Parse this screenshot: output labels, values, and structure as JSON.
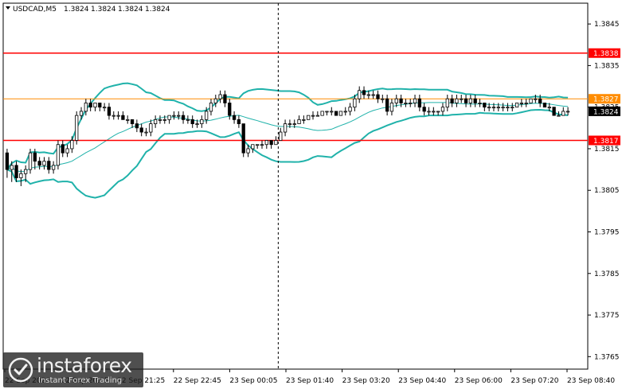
{
  "header": {
    "symbol_label": "USDCAD,M5",
    "ohlc": [
      "1.3824",
      "1.3824",
      "1.3824",
      "1.3824"
    ]
  },
  "logo": {
    "brand": "instaforex",
    "tagline": "Instant Forex Trading",
    "icon": "instaforex-logo-icon"
  },
  "colors": {
    "candle": "#000000",
    "bollinger": "#20b2aa",
    "level_line": "#ff0000",
    "ask_line": "#ff8c00",
    "price_label_bg": "#ff0000",
    "current_label_bg": "#000000",
    "grid_vline": "#000000",
    "axis_text": "#000000"
  },
  "chart_data": {
    "type": "candlestick",
    "symbol": "USDCAD",
    "timeframe": "M5",
    "ylim": [
      1.3762,
      1.385
    ],
    "yticks": [
      "1.3845",
      "1.3835",
      "1.3825",
      "1.3815",
      "1.3805",
      "1.3795",
      "1.3785",
      "1.3775",
      "1.3765"
    ],
    "xticks": [
      "22 Sep 2020",
      "22 Sep 20:05",
      "22 Sep 21:25",
      "22 Sep 22:45",
      "23 Sep 00:05",
      "23 Sep 01:40",
      "23 Sep 03:20",
      "23 Sep 04:40",
      "23 Sep 06:00",
      "23 Sep 07:20",
      "23 Sep 08:40"
    ],
    "horizontal_levels": [
      {
        "price": 1.3838,
        "label": "1.3838",
        "style": "resistance"
      },
      {
        "price": 1.3817,
        "label": "1.3817",
        "style": "support"
      }
    ],
    "ask_line": {
      "price": 1.3827,
      "label": "1.3827"
    },
    "current_price": {
      "price": 1.3824,
      "label": "1.3824"
    },
    "period_separator_index": 59,
    "candles": [
      [
        1.3814,
        1.3815,
        1.3808,
        1.381
      ],
      [
        1.381,
        1.3812,
        1.3807,
        1.3811
      ],
      [
        1.3811,
        1.3812,
        1.3807,
        1.3808
      ],
      [
        1.3808,
        1.381,
        1.3806,
        1.3809
      ],
      [
        1.3809,
        1.3811,
        1.3807,
        1.381
      ],
      [
        1.381,
        1.3815,
        1.3809,
        1.3814
      ],
      [
        1.3814,
        1.3815,
        1.381,
        1.3812
      ],
      [
        1.3812,
        1.3813,
        1.381,
        1.3811
      ],
      [
        1.3811,
        1.3813,
        1.381,
        1.3812
      ],
      [
        1.3812,
        1.3813,
        1.3809,
        1.381
      ],
      [
        1.381,
        1.3812,
        1.3809,
        1.3811
      ],
      [
        1.3811,
        1.3817,
        1.381,
        1.3816
      ],
      [
        1.3816,
        1.3817,
        1.3813,
        1.3814
      ],
      [
        1.3814,
        1.3816,
        1.3813,
        1.3815
      ],
      [
        1.3815,
        1.3818,
        1.3814,
        1.3817
      ],
      [
        1.3817,
        1.3824,
        1.3816,
        1.3823
      ],
      [
        1.3823,
        1.3825,
        1.3822,
        1.3824
      ],
      [
        1.3824,
        1.3827,
        1.3823,
        1.3826
      ],
      [
        1.3826,
        1.3827,
        1.3824,
        1.3825
      ],
      [
        1.3825,
        1.3826,
        1.3824,
        1.3826
      ],
      [
        1.3826,
        1.3826,
        1.3824,
        1.3825
      ],
      [
        1.3825,
        1.3826,
        1.3824,
        1.3825
      ],
      [
        1.3825,
        1.3826,
        1.3822,
        1.3823
      ],
      [
        1.3823,
        1.3824,
        1.3822,
        1.3823
      ],
      [
        1.3823,
        1.3824,
        1.3822,
        1.3823
      ],
      [
        1.3823,
        1.3824,
        1.3822,
        1.3822
      ],
      [
        1.3822,
        1.3823,
        1.3821,
        1.3822
      ],
      [
        1.3822,
        1.3822,
        1.382,
        1.3821
      ],
      [
        1.3821,
        1.3822,
        1.3819,
        1.382
      ],
      [
        1.382,
        1.3821,
        1.3818,
        1.3819
      ],
      [
        1.3819,
        1.382,
        1.3818,
        1.3819
      ],
      [
        1.3819,
        1.3822,
        1.3818,
        1.3821
      ],
      [
        1.3821,
        1.3823,
        1.382,
        1.3822
      ],
      [
        1.3822,
        1.3823,
        1.3821,
        1.3822
      ],
      [
        1.3822,
        1.3823,
        1.3821,
        1.3822
      ],
      [
        1.3822,
        1.3823,
        1.3821,
        1.3823
      ],
      [
        1.3823,
        1.3824,
        1.3822,
        1.3823
      ],
      [
        1.3823,
        1.3824,
        1.3822,
        1.3823
      ],
      [
        1.3823,
        1.3824,
        1.3821,
        1.3822
      ],
      [
        1.3822,
        1.3823,
        1.3821,
        1.3822
      ],
      [
        1.3822,
        1.3823,
        1.382,
        1.3821
      ],
      [
        1.3821,
        1.3822,
        1.382,
        1.3821
      ],
      [
        1.3821,
        1.3823,
        1.382,
        1.3822
      ],
      [
        1.3822,
        1.3825,
        1.3821,
        1.3824
      ],
      [
        1.3824,
        1.3827,
        1.3823,
        1.3826
      ],
      [
        1.3826,
        1.3828,
        1.3825,
        1.3827
      ],
      [
        1.3827,
        1.3829,
        1.3826,
        1.3828
      ],
      [
        1.3828,
        1.3829,
        1.3825,
        1.3826
      ],
      [
        1.3826,
        1.3827,
        1.3822,
        1.3823
      ],
      [
        1.3823,
        1.3824,
        1.3821,
        1.3822
      ],
      [
        1.3822,
        1.3823,
        1.382,
        1.3821
      ],
      [
        1.3821,
        1.3821,
        1.3813,
        1.3814
      ],
      [
        1.3814,
        1.3816,
        1.3813,
        1.3815
      ],
      [
        1.3815,
        1.3816,
        1.3814,
        1.3816
      ],
      [
        1.3816,
        1.3816,
        1.3815,
        1.3816
      ],
      [
        1.3816,
        1.3817,
        1.3815,
        1.3816
      ],
      [
        1.3816,
        1.3817,
        1.3815,
        1.3817
      ],
      [
        1.3817,
        1.3817,
        1.3815,
        1.3816
      ],
      [
        1.3816,
        1.3818,
        1.3816,
        1.3817
      ],
      [
        1.3817,
        1.382,
        1.3817,
        1.3819
      ],
      [
        1.3819,
        1.3822,
        1.3818,
        1.3821
      ],
      [
        1.3821,
        1.3822,
        1.382,
        1.3821
      ],
      [
        1.3821,
        1.3822,
        1.382,
        1.3821
      ],
      [
        1.3821,
        1.3823,
        1.3821,
        1.3822
      ],
      [
        1.3822,
        1.3823,
        1.3821,
        1.3822
      ],
      [
        1.3822,
        1.3823,
        1.3822,
        1.3823
      ],
      [
        1.3823,
        1.3824,
        1.3822,
        1.3823
      ],
      [
        1.3823,
        1.3824,
        1.3823,
        1.3823
      ],
      [
        1.3823,
        1.3824,
        1.3823,
        1.3824
      ],
      [
        1.3824,
        1.3824,
        1.3823,
        1.3824
      ],
      [
        1.3824,
        1.3825,
        1.3823,
        1.3824
      ],
      [
        1.3824,
        1.3824,
        1.3823,
        1.3823
      ],
      [
        1.3823,
        1.3824,
        1.3823,
        1.3824
      ],
      [
        1.3824,
        1.3825,
        1.3823,
        1.3824
      ],
      [
        1.3824,
        1.3826,
        1.3823,
        1.3825
      ],
      [
        1.3825,
        1.3828,
        1.3824,
        1.3827
      ],
      [
        1.3827,
        1.383,
        1.3826,
        1.3829
      ],
      [
        1.3829,
        1.383,
        1.3827,
        1.3828
      ],
      [
        1.3828,
        1.3829,
        1.3827,
        1.3828
      ],
      [
        1.3828,
        1.3829,
        1.3827,
        1.3828
      ],
      [
        1.3828,
        1.3829,
        1.3826,
        1.3827
      ],
      [
        1.3827,
        1.3828,
        1.3826,
        1.3827
      ],
      [
        1.3827,
        1.3828,
        1.3823,
        1.3824
      ],
      [
        1.3824,
        1.3827,
        1.3823,
        1.3826
      ],
      [
        1.3826,
        1.3828,
        1.3825,
        1.3827
      ],
      [
        1.3827,
        1.3828,
        1.3825,
        1.3826
      ],
      [
        1.3826,
        1.3827,
        1.3825,
        1.3826
      ],
      [
        1.3826,
        1.3827,
        1.3825,
        1.3826
      ],
      [
        1.3826,
        1.3828,
        1.3825,
        1.3827
      ],
      [
        1.3827,
        1.3828,
        1.3824,
        1.3825
      ],
      [
        1.3825,
        1.3826,
        1.3823,
        1.3824
      ],
      [
        1.3824,
        1.3825,
        1.3823,
        1.3824
      ],
      [
        1.3824,
        1.3825,
        1.3823,
        1.3824
      ],
      [
        1.3824,
        1.3824,
        1.3823,
        1.3824
      ],
      [
        1.3824,
        1.3826,
        1.3823,
        1.3825
      ],
      [
        1.3825,
        1.3828,
        1.3824,
        1.3827
      ],
      [
        1.3827,
        1.3828,
        1.3825,
        1.3826
      ],
      [
        1.3826,
        1.3828,
        1.3825,
        1.3827
      ],
      [
        1.3827,
        1.3828,
        1.3826,
        1.3827
      ],
      [
        1.3827,
        1.3828,
        1.3825,
        1.3826
      ],
      [
        1.3826,
        1.3828,
        1.3825,
        1.3827
      ],
      [
        1.3827,
        1.3828,
        1.3825,
        1.3826
      ],
      [
        1.3826,
        1.3827,
        1.3825,
        1.3826
      ],
      [
        1.3826,
        1.3826,
        1.3824,
        1.3825
      ],
      [
        1.3825,
        1.3826,
        1.3824,
        1.3825
      ],
      [
        1.3825,
        1.3826,
        1.3824,
        1.3825
      ],
      [
        1.3825,
        1.3826,
        1.3824,
        1.3825
      ],
      [
        1.3825,
        1.3826,
        1.3824,
        1.3825
      ],
      [
        1.3825,
        1.3826,
        1.3824,
        1.3825
      ],
      [
        1.3825,
        1.3826,
        1.3824,
        1.3825
      ],
      [
        1.3825,
        1.3826,
        1.3825,
        1.3826
      ],
      [
        1.3826,
        1.3827,
        1.3825,
        1.3826
      ],
      [
        1.3826,
        1.3827,
        1.3825,
        1.3826
      ],
      [
        1.3826,
        1.3827,
        1.3826,
        1.3827
      ],
      [
        1.3827,
        1.3828,
        1.3826,
        1.3827
      ],
      [
        1.3827,
        1.3828,
        1.3825,
        1.3826
      ],
      [
        1.3826,
        1.3826,
        1.3825,
        1.3825
      ],
      [
        1.3825,
        1.3826,
        1.3824,
        1.3825
      ],
      [
        1.3825,
        1.3825,
        1.3823,
        1.3823
      ],
      [
        1.3823,
        1.3824,
        1.3823,
        1.3823
      ],
      [
        1.3823,
        1.3825,
        1.3823,
        1.3824
      ],
      [
        1.3824,
        1.3825,
        1.3823,
        1.3824
      ]
    ]
  }
}
